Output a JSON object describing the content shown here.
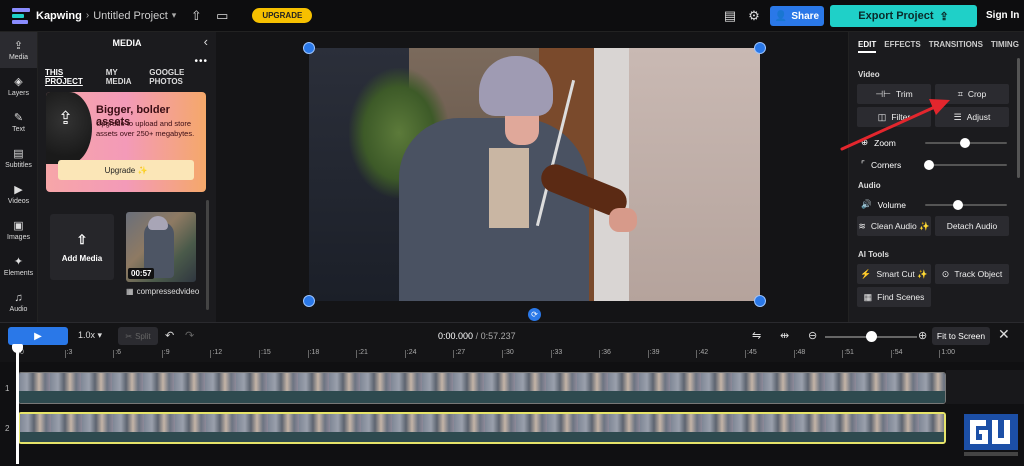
{
  "topbar": {
    "brand": "Kapwing",
    "crumb_sep": "›",
    "project": "Untitled Project",
    "upgrade": "UPGRADE",
    "share": "Share",
    "export": "Export Project",
    "signin": "Sign In"
  },
  "rail": [
    {
      "icon": "cloud-upload-icon",
      "label": "Media",
      "glyph": "⇪"
    },
    {
      "icon": "layers-icon",
      "label": "Layers",
      "glyph": "◈"
    },
    {
      "icon": "text-icon",
      "label": "Text",
      "glyph": "✎"
    },
    {
      "icon": "subtitles-icon",
      "label": "Subtitles",
      "glyph": "▤"
    },
    {
      "icon": "videos-icon",
      "label": "Videos",
      "glyph": "▶"
    },
    {
      "icon": "images-icon",
      "label": "Images",
      "glyph": "▣"
    },
    {
      "icon": "elements-icon",
      "label": "Elements",
      "glyph": "✦"
    },
    {
      "icon": "audio-icon",
      "label": "Audio",
      "glyph": "♫"
    }
  ],
  "media_panel": {
    "title": "MEDIA",
    "tabs": [
      "THIS PROJECT",
      "MY MEDIA",
      "GOOGLE PHOTOS"
    ],
    "more": "•••",
    "promo_heading": "Bigger, bolder assets",
    "promo_text": "Upgrade to upload and store assets over 250+ megabytes.",
    "promo_button": "Upgrade ✨",
    "add_media": "Add Media",
    "thumb_duration": "00:57",
    "thumb_name": "compressedvideo"
  },
  "right_panel": {
    "tabs": [
      "EDIT",
      "EFFECTS",
      "TRANSITIONS",
      "TIMING"
    ],
    "video_label": "Video",
    "trim": "Trim",
    "crop": "Crop",
    "filter": "Filter",
    "adjust": "Adjust",
    "zoom": "Zoom",
    "corners": "Corners",
    "audio_label": "Audio",
    "volume": "Volume",
    "clean_audio": "Clean Audio ✨",
    "detach_audio": "Detach Audio",
    "ai_label": "AI Tools",
    "smart_cut": "Smart Cut ✨",
    "track_object": "Track Object",
    "find_scenes": "Find Scenes"
  },
  "timeline": {
    "speed": "1.0x",
    "split": "Split",
    "current": "0:00.000",
    "total": "/ 0:57.237",
    "fit": "Fit to Screen",
    "ticks": [
      ":0",
      ":3",
      ":6",
      ":9",
      ":12",
      ":15",
      ":18",
      ":21",
      ":24",
      ":27",
      ":30",
      ":33",
      ":36",
      ":39",
      ":42",
      ":45",
      ":48",
      ":51",
      ":54",
      "1:00"
    ],
    "tracks": [
      "1",
      "2"
    ]
  },
  "colors": {
    "accent_blue": "#2a78e8",
    "export_teal": "#1fd0c8",
    "upgrade_yellow": "#f6c000",
    "annotation_red": "#e3262d"
  }
}
